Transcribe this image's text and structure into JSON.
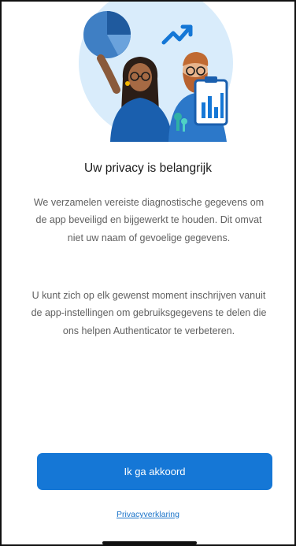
{
  "screen": {
    "title": "Uw privacy is belangrijk",
    "paragraph1": "We verzamelen vereiste diagnostische gegevens om de app beveiligd en bijgewerkt te houden. Dit omvat niet uw naam of gevoelige gegevens.",
    "paragraph2": "U kunt zich op elk gewenst moment inschrijven vanuit de app-instellingen om gebruiksgegevens te delen die ons helpen Authenticator te verbeteren."
  },
  "actions": {
    "agree_label": "Ik ga akkoord",
    "privacy_link": "Privacyverklaring"
  },
  "colors": {
    "accent": "#1577d6",
    "link": "#1a73c9",
    "illustration_bg": "#d9ecfb"
  },
  "icons": {
    "illustration": "privacy-illustration-icon",
    "pie": "pie-chart-icon",
    "trend": "trend-arrow-icon",
    "clipboard": "clipboard-chart-icon",
    "keys": "keys-icon"
  }
}
